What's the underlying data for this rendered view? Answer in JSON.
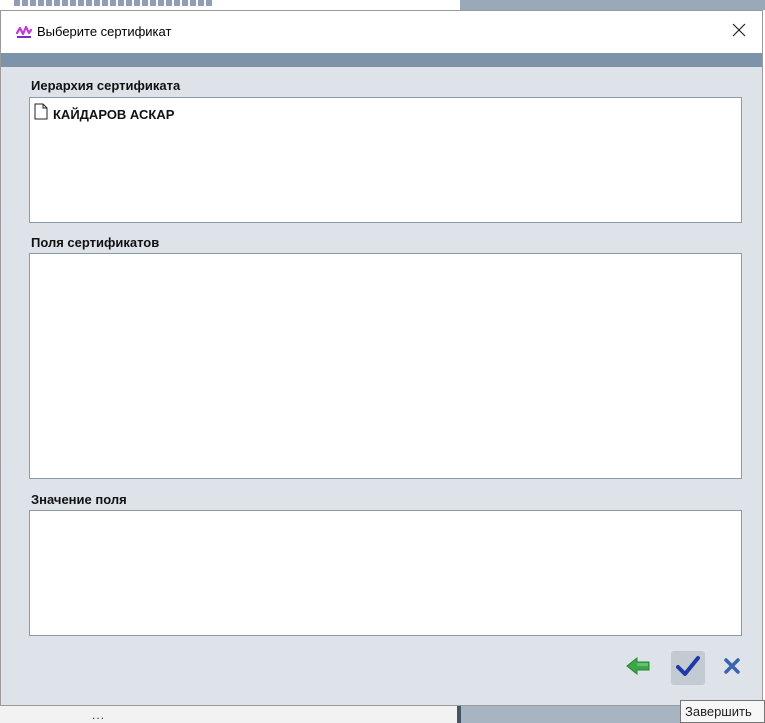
{
  "dialog": {
    "title": "Выберите сертификат",
    "close_icon": "close-icon",
    "app_icon": "app-logo-icon"
  },
  "sections": {
    "hierarchy_label": "Иерархия сертификата",
    "fields_label": "Поля сертификатов",
    "value_label": "Значение поля"
  },
  "hierarchy": {
    "items": [
      {
        "label": "КАЙДАРОВ АСКАР",
        "icon": "document-icon"
      }
    ]
  },
  "footer": {
    "back_icon": "back-arrow-icon",
    "finish_icon": "checkmark-icon",
    "cancel_icon": "cancel-x-icon"
  },
  "tooltip": {
    "text": "Завершить"
  },
  "background": {
    "dots": "..."
  },
  "colors": {
    "dialog_bg": "#dee3ea",
    "frame_band": "#7d93a9",
    "back_green": "#3aa84a",
    "check_blue": "#1f3aa8",
    "cancel_blue": "#3b63b0"
  }
}
